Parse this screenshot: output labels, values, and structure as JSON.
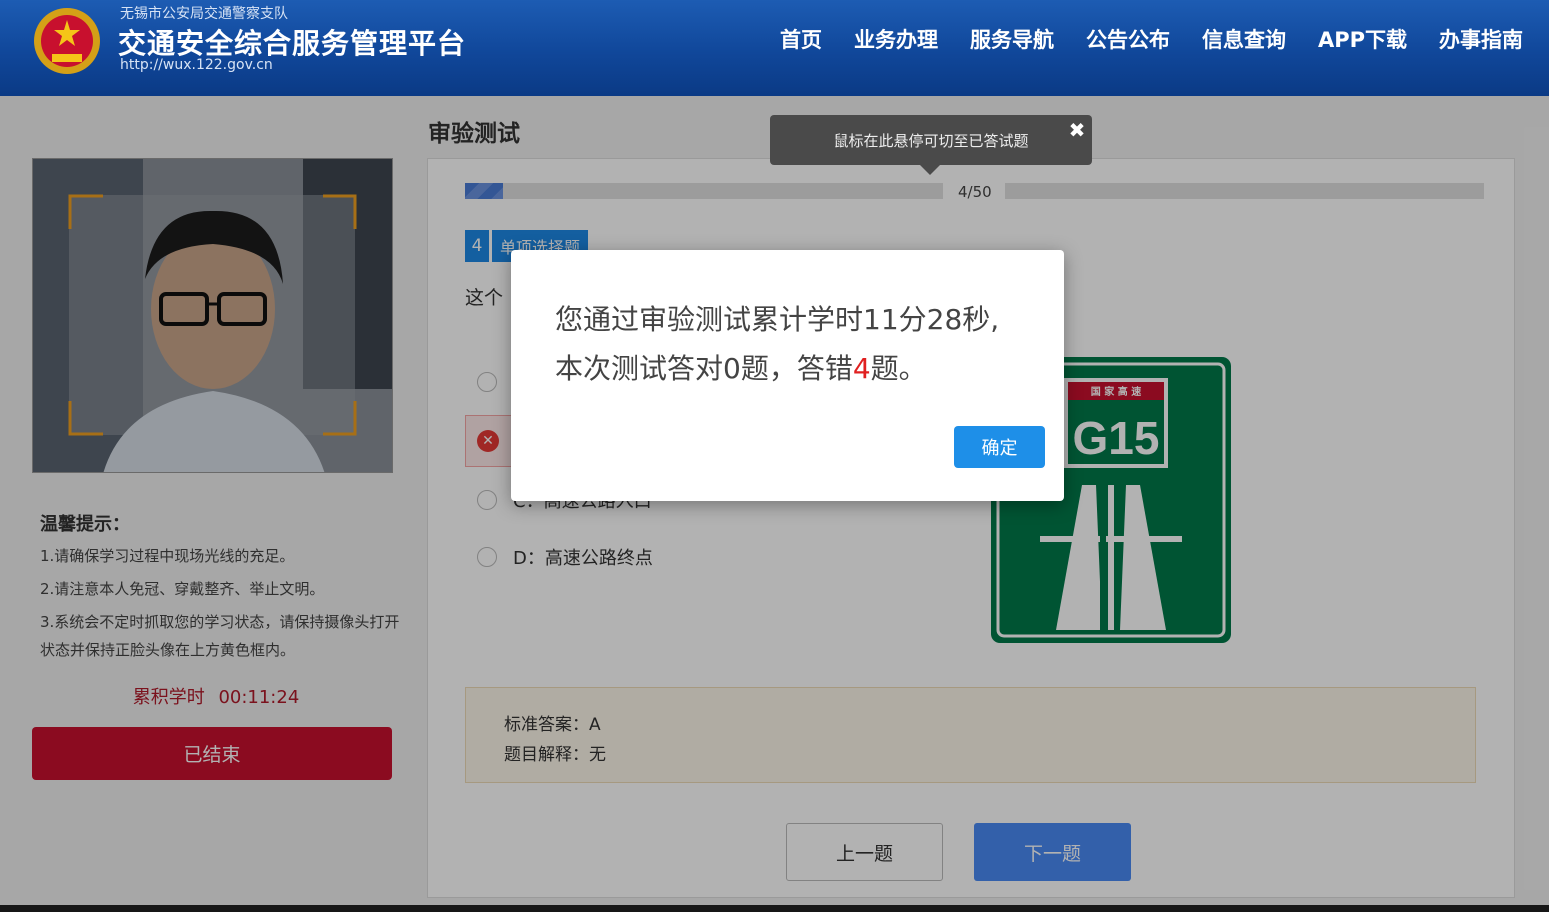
{
  "header": {
    "org_name": "无锡市公安局交通警察支队",
    "title": "交通安全综合服务管理平台",
    "url": "http://wux.122.gov.cn",
    "nav": [
      "首页",
      "业务办理",
      "服务导航",
      "公告公布",
      "信息查询",
      "APP下载",
      "办事指南"
    ]
  },
  "left": {
    "tips_title": "温馨提示：",
    "tips": [
      "1.请确保学习过程中现场光线的充足。",
      "2.请注意本人免冠、穿戴整齐、举止文明。",
      "3.系统会不定时抓取您的学习状态，请保持摄像头打开状态并保持正脸头像在上方黄色框内。"
    ],
    "study_time_label": "累积学时",
    "study_time_value": "00:11:24",
    "end_button": "已结束"
  },
  "main": {
    "page_title": "审验测试",
    "progress_text": "4/50",
    "progress_fraction": 0.08,
    "question_number": "4",
    "question_type": "单项选择题",
    "question_text_visible": "这个",
    "option_d": "D：高速公路终点",
    "option_c_partial": "C：高速公路入口",
    "sign": {
      "header_text": "国 家 高 速",
      "code": "G15",
      "background": "#00794a"
    },
    "answer_label": "标准答案：A",
    "explain_label": "题目解释：无",
    "prev_button": "上一题",
    "next_button": "下一题"
  },
  "tooltip": {
    "text": "鼠标在此悬停可切至已答试题",
    "close": "✖"
  },
  "dialog": {
    "msg_part1": "您通过审验测试累计学时11分28秒,本次测试答对0题，答错",
    "wrong_count": "4",
    "msg_part2": "题。",
    "confirm": "确定"
  },
  "colors": {
    "header_blue": "#10479a",
    "accent_red": "#c8102e",
    "primary_blue": "#1e8fe8"
  }
}
